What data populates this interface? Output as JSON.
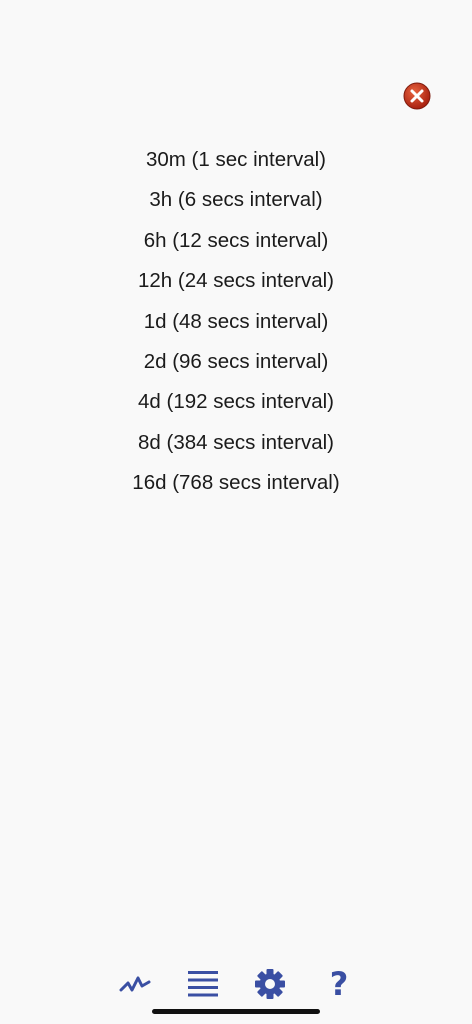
{
  "colors": {
    "background": "#f9f9f9",
    "text": "#1b1b1b",
    "tab_icon": "#3a4fa3",
    "close_icon_fill": "#c8331c",
    "home_indicator": "#111111"
  },
  "close_button": {
    "icon": "close-circle-icon"
  },
  "intervals": [
    {
      "label": "30m (1 sec interval)"
    },
    {
      "label": "3h (6 secs interval)"
    },
    {
      "label": "6h (12 secs interval)"
    },
    {
      "label": "12h (24 secs interval)"
    },
    {
      "label": "1d (48 secs interval)"
    },
    {
      "label": "2d (96 secs interval)"
    },
    {
      "label": "4d (192 secs interval)"
    },
    {
      "label": "8d (384 secs interval)"
    },
    {
      "label": "16d (768 secs interval)"
    }
  ],
  "tab_bar": {
    "tabs": [
      {
        "icon": "line-chart-icon"
      },
      {
        "icon": "list-icon"
      },
      {
        "icon": "gear-icon"
      },
      {
        "icon": "help-icon",
        "glyph": "?"
      }
    ]
  }
}
